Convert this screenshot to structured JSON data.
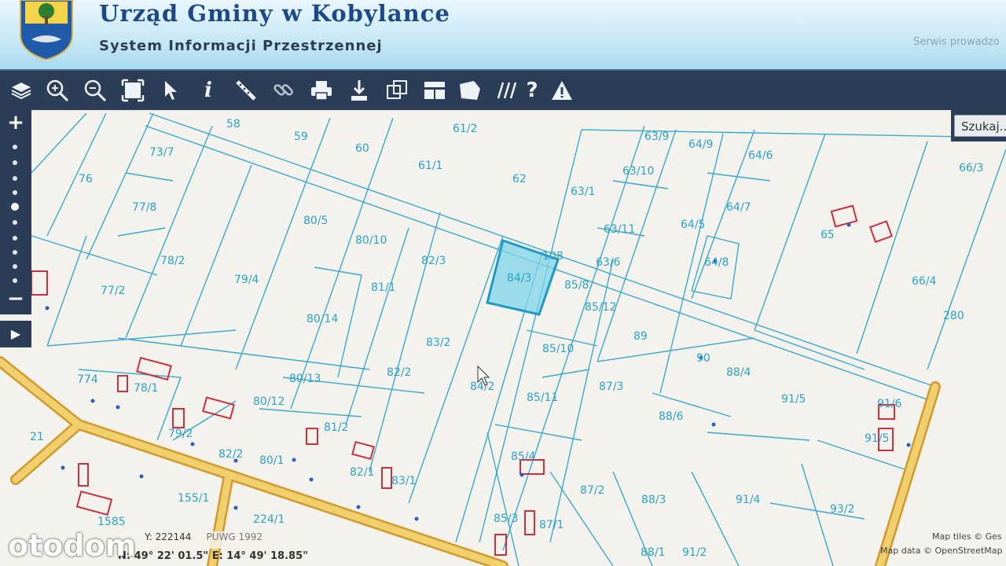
{
  "header": {
    "title": "Urząd Gminy w Kobylance",
    "subtitle": "System Informacji Przestrzennej",
    "provider": "Serwis prowadzo"
  },
  "toolbar": {
    "tools": [
      "layers-icon",
      "zoom-in-icon",
      "zoom-out-icon",
      "zoom-extent-icon",
      "select-arrow-icon",
      "info-icon",
      "measure-icon",
      "link-icon",
      "print-icon",
      "download-icon",
      "copy-icon",
      "layout-icon",
      "area-icon",
      "hatch-icon",
      "help-icon",
      "warning-icon"
    ]
  },
  "search": {
    "label": "Szukaj..."
  },
  "zoom": {
    "plus": "+",
    "minus": "−"
  },
  "play": {
    "label": "▶"
  },
  "parcels": [
    "58",
    "59",
    "60",
    "61/2",
    "61/1",
    "62",
    "63/9",
    "64/9",
    "64/6",
    "66/3",
    "76",
    "73/7",
    "77/8",
    "80/5",
    "80/10",
    "63/1",
    "63/10",
    "64/7",
    "63/11",
    "64/5",
    "65",
    "82/3",
    "84/3",
    "108",
    "63/6",
    "64/8",
    "78/2",
    "79/4",
    "81/1",
    "85/8",
    "85/12",
    "66/4",
    "77/2",
    "80/14",
    "83/2",
    "89",
    "280",
    "85/10",
    "90",
    "88/4",
    "774",
    "78/1",
    "80/13",
    "82/2",
    "84/2",
    "85/11",
    "87/3",
    "91/5",
    "91/6",
    "80/12",
    "81/2",
    "88/6",
    "91/5",
    "21",
    "79/2",
    "80/1",
    "82/1",
    "83/1",
    "85/4",
    "82/2",
    "155/1",
    "224/1",
    "87/2",
    "88/3",
    "91/4",
    "93/2",
    "85/3",
    "87/1",
    "1585",
    "88/1",
    "91/2"
  ],
  "status": {
    "coords_label": "Y:",
    "y_value": "222144",
    "crs": "PUWG 1992",
    "latlon": "N: 49° 22' 01.5\"  E: 14° 49' 18.85\""
  },
  "attribution": {
    "tiles": "Map tiles © Ges",
    "data": "Map data © OpenStreetMap"
  },
  "watermark": "otodom",
  "colors": {
    "toolbar": "#2c3d57",
    "parcel_line": "#2aa3c7",
    "selected_fill": "#7fd3ea",
    "building": "#cc2f3d",
    "road": "#e6b94a"
  }
}
